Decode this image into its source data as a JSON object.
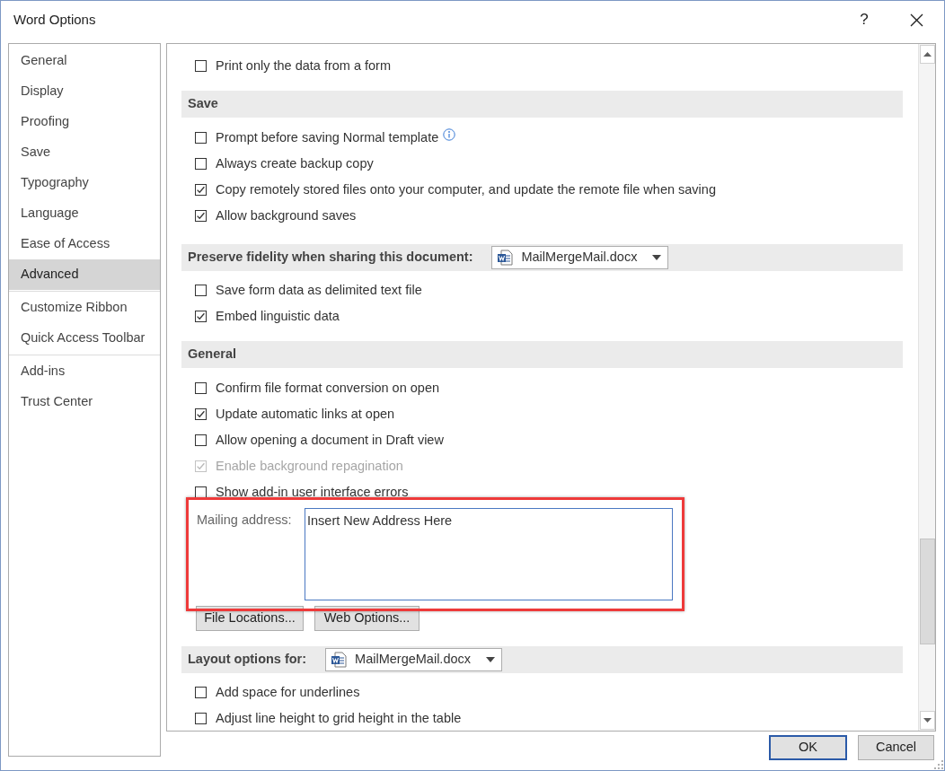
{
  "window": {
    "title": "Word Options",
    "help": "?"
  },
  "sidebar": {
    "groups": [
      {
        "items": [
          {
            "label": "General",
            "selected": false
          },
          {
            "label": "Display",
            "selected": false
          },
          {
            "label": "Proofing",
            "selected": false
          },
          {
            "label": "Save",
            "selected": false
          },
          {
            "label": "Typography",
            "selected": false
          },
          {
            "label": "Language",
            "selected": false
          },
          {
            "label": "Ease of Access",
            "selected": false
          },
          {
            "label": "Advanced",
            "selected": true
          }
        ]
      },
      {
        "items": [
          {
            "label": "Customize Ribbon",
            "selected": false
          },
          {
            "label": "Quick Access Toolbar",
            "selected": false
          }
        ]
      },
      {
        "items": [
          {
            "label": "Add-ins",
            "selected": false
          },
          {
            "label": "Trust Center",
            "selected": false
          }
        ]
      }
    ]
  },
  "content": {
    "items": [
      {
        "kind": "checkbox",
        "label": "Print only the data from a form",
        "checked": false,
        "disabled": false,
        "info": false
      },
      {
        "kind": "header",
        "label": "Save"
      },
      {
        "kind": "checkbox",
        "label": "Prompt before saving Normal template",
        "checked": false,
        "disabled": false,
        "info": true
      },
      {
        "kind": "checkbox",
        "label": "Always create backup copy",
        "checked": false,
        "disabled": false,
        "info": false
      },
      {
        "kind": "checkbox",
        "label": "Copy remotely stored files onto your computer, and update the remote file when saving",
        "checked": true,
        "disabled": false,
        "info": false
      },
      {
        "kind": "checkbox",
        "label": "Allow background saves",
        "checked": true,
        "disabled": false,
        "info": false
      },
      {
        "kind": "header",
        "label": "Preserve fidelity when sharing this document:",
        "dropdown": "MailMergeMail.docx"
      },
      {
        "kind": "checkbox",
        "label": "Save form data as delimited text file",
        "checked": false,
        "disabled": false,
        "info": false
      },
      {
        "kind": "checkbox",
        "label": "Embed linguistic data",
        "checked": true,
        "disabled": false,
        "info": false
      },
      {
        "kind": "header",
        "label": "General"
      },
      {
        "kind": "checkbox",
        "label": "Confirm file format conversion on open",
        "checked": false,
        "disabled": false,
        "info": false
      },
      {
        "kind": "checkbox",
        "label": "Update automatic links at open",
        "checked": true,
        "disabled": false,
        "info": false
      },
      {
        "kind": "checkbox",
        "label": "Allow opening a document in Draft view",
        "checked": false,
        "disabled": false,
        "info": false
      },
      {
        "kind": "checkbox",
        "label": "Enable background repagination",
        "checked": true,
        "disabled": true,
        "info": false
      },
      {
        "kind": "checkbox",
        "label": "Show add-in user interface errors",
        "checked": false,
        "disabled": false,
        "info": false
      },
      {
        "kind": "textarea",
        "label": "Mailing address:",
        "value": "Insert New Address Here",
        "highlighted": true
      },
      {
        "kind": "buttons",
        "buttons": [
          "File Locations...",
          "Web Options..."
        ]
      },
      {
        "kind": "header",
        "label": "Layout options for:",
        "dropdown": "MailMergeMail.docx"
      },
      {
        "kind": "checkbox",
        "label": "Add space for underlines",
        "checked": false,
        "disabled": false,
        "info": false
      },
      {
        "kind": "checkbox",
        "label": "Adjust line height to grid height in the table",
        "checked": false,
        "disabled": false,
        "info": false
      }
    ]
  },
  "footer": {
    "buttons": [
      {
        "label": "OK",
        "default": true
      },
      {
        "label": "Cancel",
        "default": false
      }
    ]
  }
}
